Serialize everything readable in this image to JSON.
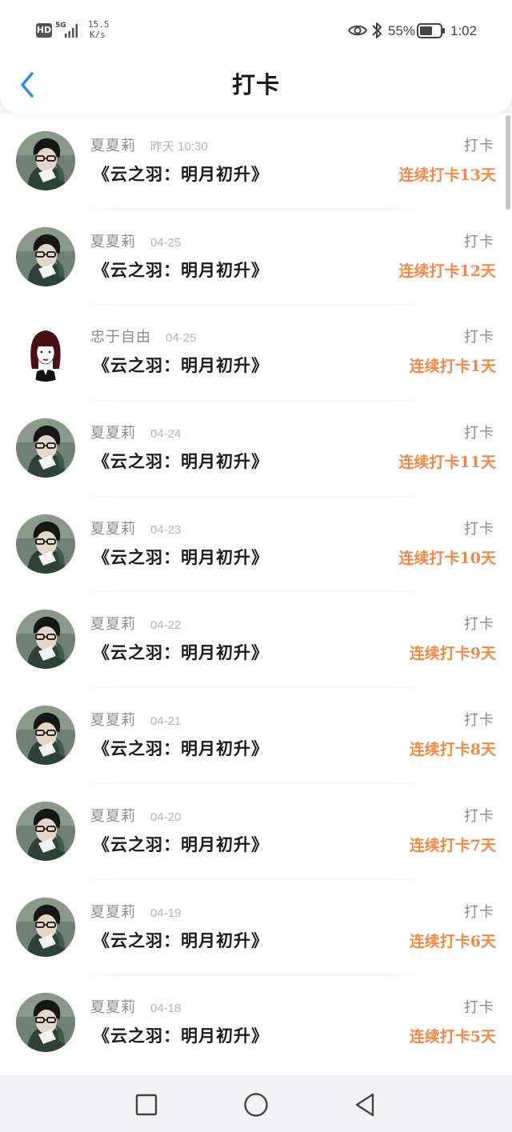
{
  "status_bar": {
    "hd": "HD",
    "network": "5G",
    "speed_value": "15.5",
    "speed_unit": "K/s",
    "battery": "55%",
    "time": "1:02"
  },
  "header": {
    "title": "打卡"
  },
  "checkins": [
    {
      "user": "夏夏莉",
      "date": "昨天 10:30",
      "book": "《云之羽：明月初升》",
      "type": "打卡",
      "streak": "连续打卡13天",
      "avatar": "boy-avatar"
    },
    {
      "user": "夏夏莉",
      "date": "04-25",
      "book": "《云之羽：明月初升》",
      "type": "打卡",
      "streak": "连续打卡12天",
      "avatar": "boy-avatar"
    },
    {
      "user": "忠于自由",
      "date": "04-25",
      "book": "《云之羽：明月初升》",
      "type": "打卡",
      "streak": "连续打卡1天",
      "avatar": "girl-avatar"
    },
    {
      "user": "夏夏莉",
      "date": "04-24",
      "book": "《云之羽：明月初升》",
      "type": "打卡",
      "streak": "连续打卡11天",
      "avatar": "boy-avatar"
    },
    {
      "user": "夏夏莉",
      "date": "04-23",
      "book": "《云之羽：明月初升》",
      "type": "打卡",
      "streak": "连续打卡10天",
      "avatar": "boy-avatar"
    },
    {
      "user": "夏夏莉",
      "date": "04-22",
      "book": "《云之羽：明月初升》",
      "type": "打卡",
      "streak": "连续打卡9天",
      "avatar": "boy-avatar"
    },
    {
      "user": "夏夏莉",
      "date": "04-21",
      "book": "《云之羽：明月初升》",
      "type": "打卡",
      "streak": "连续打卡8天",
      "avatar": "boy-avatar"
    },
    {
      "user": "夏夏莉",
      "date": "04-20",
      "book": "《云之羽：明月初升》",
      "type": "打卡",
      "streak": "连续打卡7天",
      "avatar": "boy-avatar"
    },
    {
      "user": "夏夏莉",
      "date": "04-19",
      "book": "《云之羽：明月初升》",
      "type": "打卡",
      "streak": "连续打卡6天",
      "avatar": "boy-avatar"
    },
    {
      "user": "夏夏莉",
      "date": "04-18",
      "book": "《云之羽：明月初升》",
      "type": "打卡",
      "streak": "连续打卡5天",
      "avatar": "boy-avatar"
    }
  ],
  "nav_icons": [
    "square-recents-icon",
    "circle-home-icon",
    "triangle-back-icon"
  ],
  "colors": {
    "accent": "#f08a4b",
    "back": "#2f8fe8",
    "muted": "#8b8b8b",
    "text": "#1b1b1b"
  }
}
